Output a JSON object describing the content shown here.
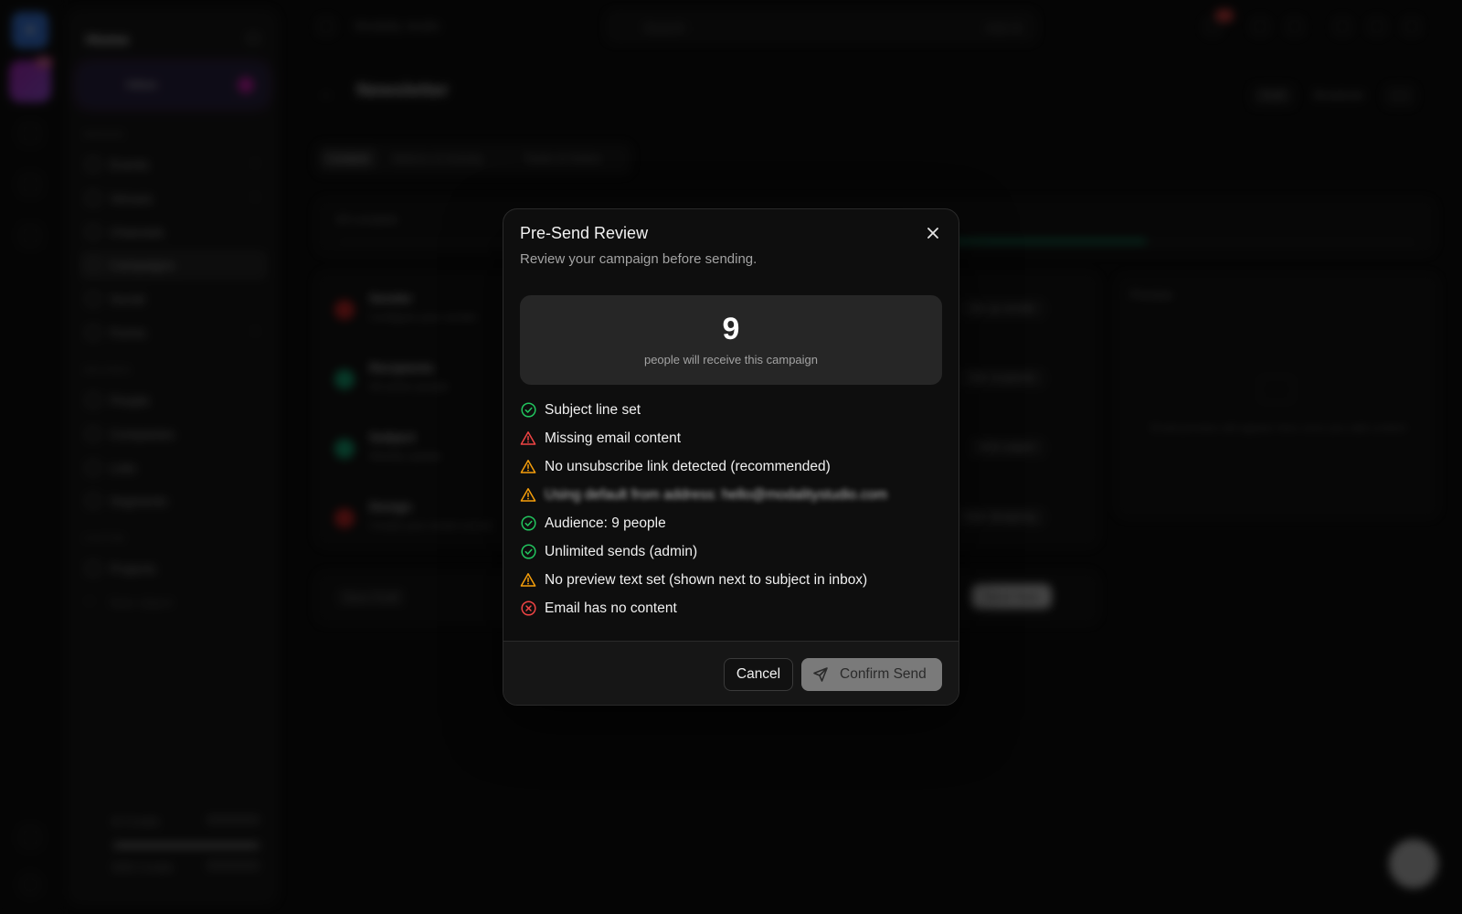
{
  "sidebar": {
    "title": "Home",
    "inbox_label": "Inbox",
    "items": [
      {
        "label": "Events"
      },
      {
        "label": "Venues"
      },
      {
        "label": "Channels"
      },
      {
        "label": "Campaigns"
      },
      {
        "label": "Social"
      },
      {
        "label": "Forms"
      },
      {
        "label": "People"
      },
      {
        "label": "Companies"
      },
      {
        "label": "Lists"
      },
      {
        "label": "Segments"
      },
      {
        "label": "Projects"
      },
      {
        "label": "New object"
      }
    ],
    "credits": [
      {
        "label": "AI Credits"
      },
      {
        "label": "SMS Credits"
      }
    ]
  },
  "topbar": {
    "workspace": "Modality studio",
    "search_placeholder": "Search",
    "ask_label": "Ask AI"
  },
  "page": {
    "title": "Newsletter",
    "status_pill": "Draft",
    "type_pill": "Broadcast",
    "tabs": [
      {
        "label": "Content"
      },
      {
        "label": "Metrics & Activity"
      },
      {
        "label": "Tasks & Notes"
      }
    ],
    "progress_label": "3/4 complete",
    "progress_fraction": 0.5,
    "steps": [
      {
        "name": "Sender",
        "sub": "Configure your sender",
        "action": "Set up sender",
        "status_color": "#dc2626"
      },
      {
        "name": "Recipients",
        "sub": "All active people",
        "action": "Edit recipients",
        "status_color": "#10b981"
      },
      {
        "name": "Subject",
        "sub": "Weekly update",
        "action": "Edit subject",
        "status_color": "#10b981"
      },
      {
        "name": "Design",
        "sub": "Create your email content",
        "action": "Start designing",
        "status_color": "#dc2626"
      }
    ],
    "save_draft": "Save Draft",
    "send_now": "Send Now",
    "preview_title": "Preview",
    "preview_text": "Email preview will appear here once you add content"
  },
  "modal": {
    "title": "Pre-Send Review",
    "subtitle": "Review your campaign before sending.",
    "recipient_count": "9",
    "recipient_caption": "people will receive this campaign",
    "checks": [
      {
        "status": "ok",
        "text": "Subject line set"
      },
      {
        "status": "error-triangle",
        "text": "Missing email content"
      },
      {
        "status": "warning",
        "text": "No unsubscribe link detected (recommended)"
      },
      {
        "status": "warning",
        "text": "Using default from address: hello@modalitystudio.com",
        "blurred": true
      },
      {
        "status": "ok",
        "text": "Audience: 9 people"
      },
      {
        "status": "ok",
        "text": "Unlimited sends (admin)"
      },
      {
        "status": "warning",
        "text": "No preview text set (shown next to subject in inbox)"
      },
      {
        "status": "error",
        "text": "Email has no content"
      }
    ],
    "cancel_label": "Cancel",
    "confirm_label": "Confirm Send"
  },
  "colors": {
    "ok": "#22c55e",
    "warning": "#f59e0b",
    "error": "#ef4444",
    "accent_progress": "#10b981"
  },
  "icons": {
    "close": "close-icon",
    "ok": "check-circle-icon",
    "warning": "warning-triangle-icon",
    "error": "x-circle-icon",
    "send": "send-icon"
  }
}
